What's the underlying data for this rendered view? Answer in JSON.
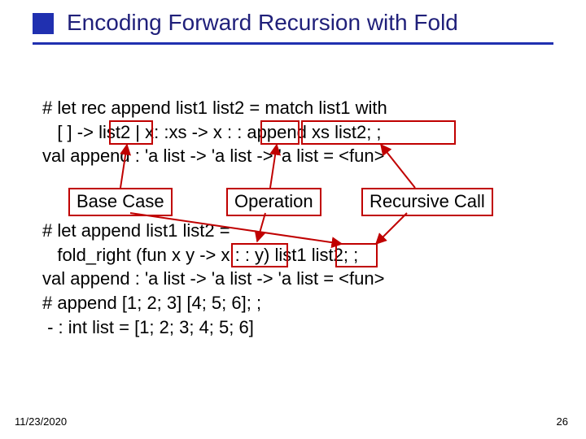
{
  "title": "Encoding Forward Recursion with Fold",
  "code1": {
    "l1": "# let rec append list1 list2 = match list1 with",
    "l2": "   [ ] -> list2 | x: :xs -> x : : append xs list2; ;",
    "l3": "val append : 'a list -> 'a list -> 'a list = <fun>"
  },
  "labels": {
    "base": "Base Case",
    "op": "Operation",
    "rec": "Recursive Call"
  },
  "code2": {
    "l1": "# let append list1 list2 =",
    "l2": "   fold_right (fun x y -> x : : y) list1 list2; ;",
    "l3": "val append : 'a list -> 'a list -> 'a list = <fun>",
    "l4": "# append [1; 2; 3] [4; 5; 6]; ;",
    "l5": " - : int list = [1; 2; 3; 4; 5; 6]"
  },
  "footer": {
    "date": "11/23/2020",
    "page": "26"
  }
}
